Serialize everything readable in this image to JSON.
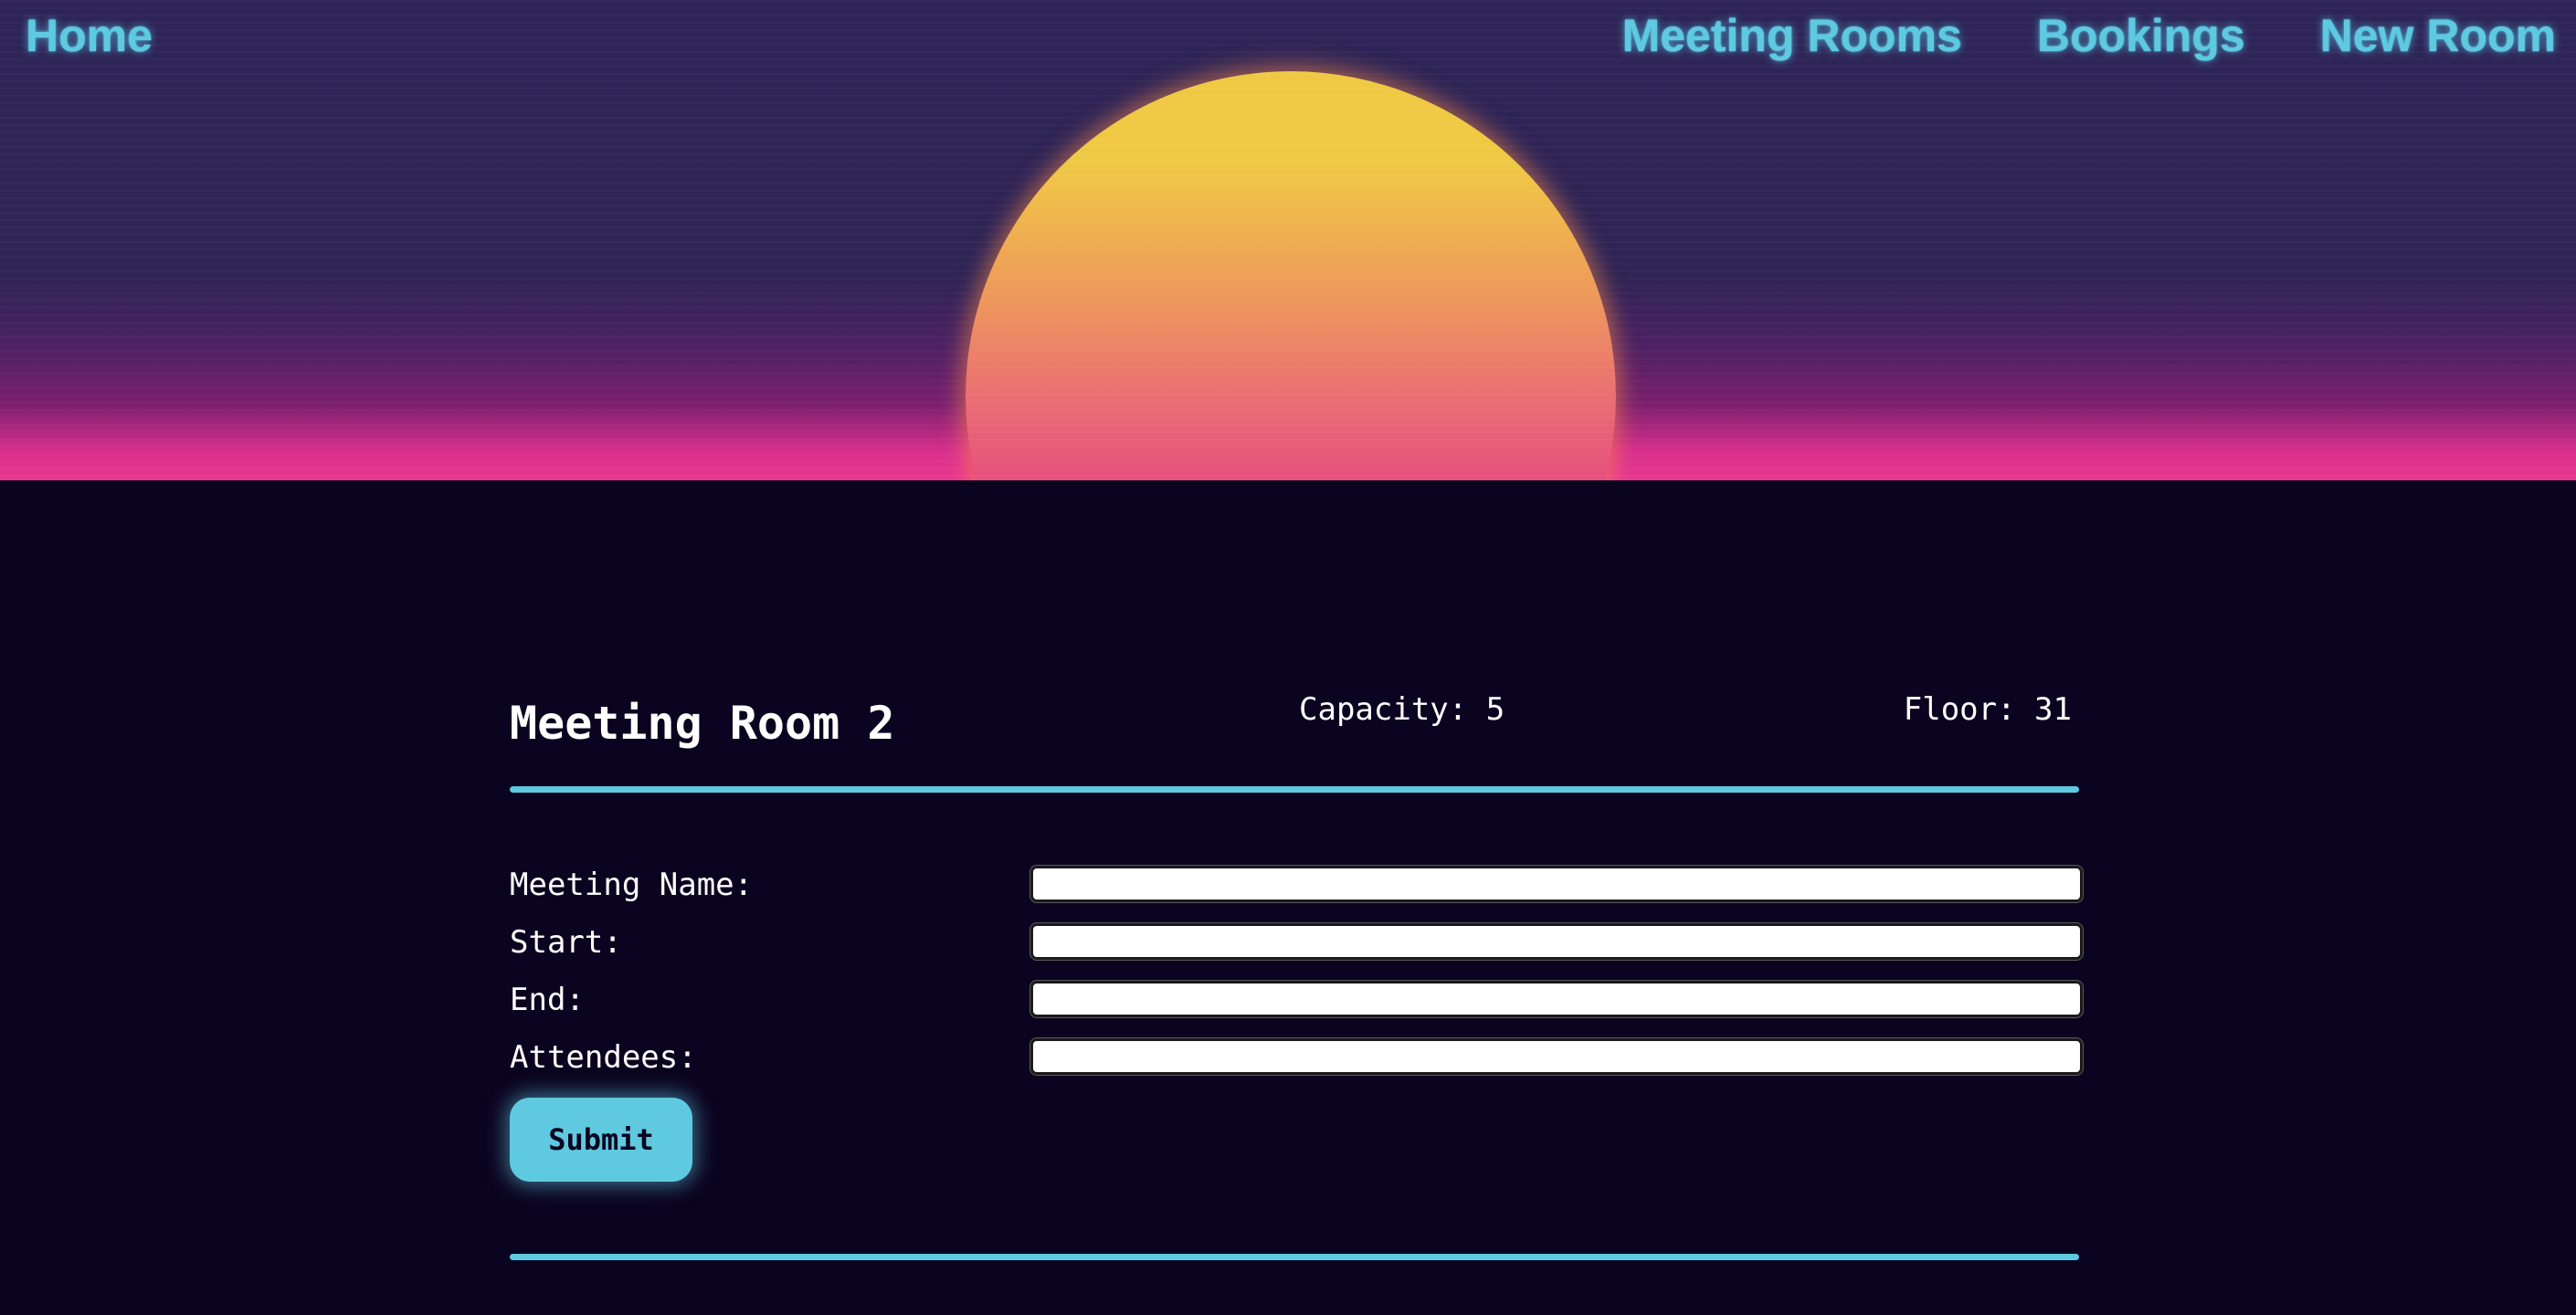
{
  "nav": {
    "home": "Home",
    "meeting_rooms": "Meeting Rooms",
    "bookings": "Bookings",
    "new_room": "New Room"
  },
  "room": {
    "title": "Meeting Room 2",
    "capacity": "Capacity: 5",
    "floor": "Floor: 31"
  },
  "form": {
    "fields": [
      {
        "label": "Meeting Name:",
        "value": ""
      },
      {
        "label": "Start:",
        "value": ""
      },
      {
        "label": "End:",
        "value": ""
      },
      {
        "label": "Attendees:",
        "value": ""
      }
    ],
    "submit_label": "Submit"
  },
  "colors": {
    "accent": "#5ec9e0",
    "background": "#0b0420",
    "sky": "#2e2457",
    "horizon_pink": "#e8388f",
    "sun_top": "#f0c944",
    "sun_bottom": "#e54d7e"
  }
}
